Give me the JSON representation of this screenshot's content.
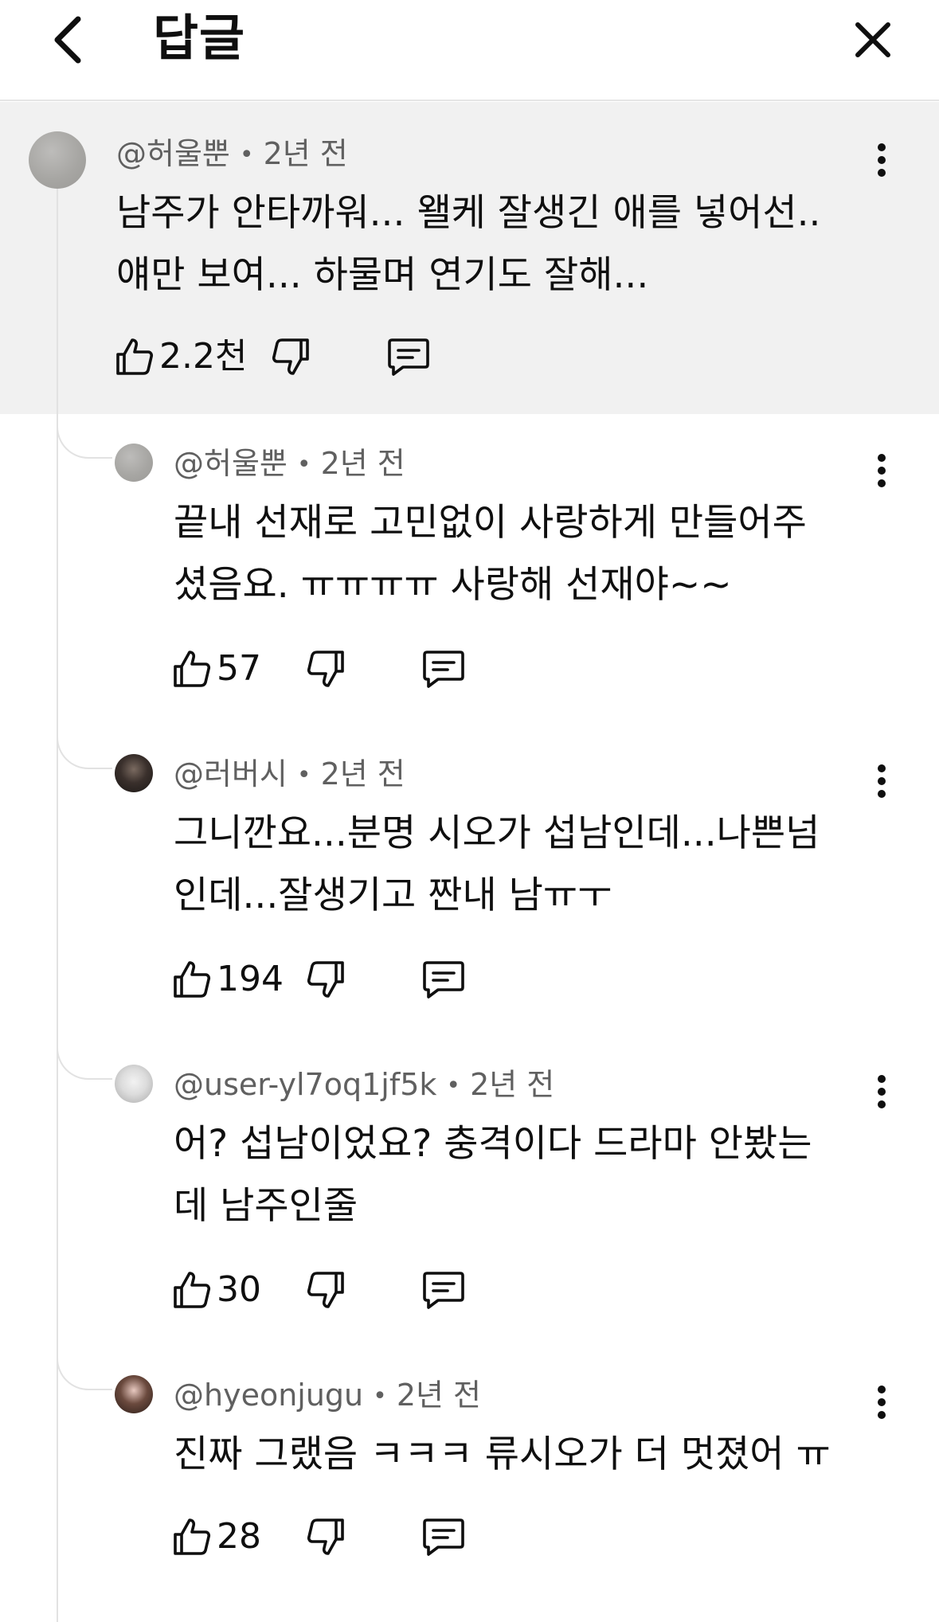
{
  "header": {
    "title": "답글",
    "back_icon": "chevron-left-icon",
    "close_icon": "close-icon"
  },
  "parent_comment": {
    "author": "@허울뿐",
    "time": "2년 전",
    "text_lines": [
      "남주가 안타까워... 왤케 잘생긴 애를 넣어선..",
      "얘만 보여... 하물며 연기도 잘해..."
    ],
    "likes": "2.2천"
  },
  "replies": [
    {
      "author": "@허울뿐",
      "time": "2년 전",
      "text_lines": [
        "끝내 선재로 고민없이 사랑하게 만들어주",
        "셨음요. ㅠㅠㅠㅠ 사랑해 선재야~~"
      ],
      "likes": "57"
    },
    {
      "author": "@러버시",
      "time": "2년 전",
      "text_lines": [
        "그니깐요...분명 시오가 섭남인데...나쁜넘",
        "인데...잘생기고 짠내 남ㅠㅜ"
      ],
      "likes": "194"
    },
    {
      "author": "@user-yl7oq1jf5k",
      "time": "2년 전",
      "text_lines": [
        "어? 섭남이었요? 충격이다 드라마 안봤는",
        "데 남주인줄"
      ],
      "likes": "30"
    },
    {
      "author": "@hyeonjugu",
      "time": "2년 전",
      "text_lines": [
        "진짜 그랬음 ㅋㅋㅋ 류시오가 더 멋졌어 ㅠ"
      ],
      "likes": "28"
    }
  ],
  "icons": {
    "like": "thumbs-up-icon",
    "dislike": "thumbs-down-icon",
    "reply": "comment-icon",
    "more": "more-vertical-icon"
  },
  "colors": {
    "highlight_background": "#f1f1f1",
    "meta_text": "#606060",
    "primary_text": "#0f0f0f",
    "thread_line": "#e2e2e2"
  }
}
